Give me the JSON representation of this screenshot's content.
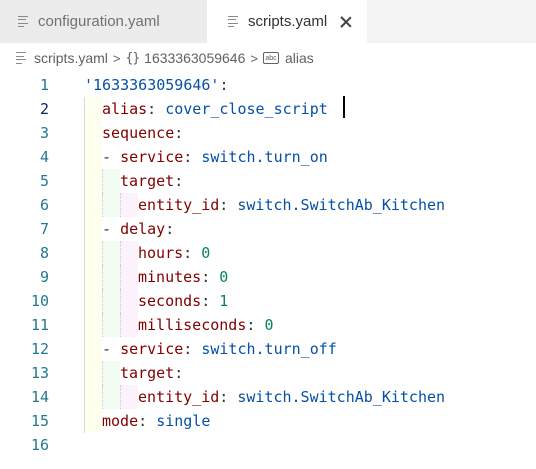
{
  "tabs": [
    {
      "label": "configuration.yaml",
      "active": false
    },
    {
      "label": "scripts.yaml",
      "active": true
    }
  ],
  "breadcrumb": {
    "file": "scripts.yaml",
    "separator": ">",
    "object": "1633363059646",
    "object_icon": "{}",
    "property": "alias",
    "property_icon": "abc"
  },
  "editor": {
    "current_line": 2,
    "lines": [
      {
        "n": "1",
        "tokens": [
          {
            "t": "str",
            "v": "'1633363059646'"
          },
          {
            "t": "punc",
            "v": ":"
          }
        ]
      },
      {
        "n": "2",
        "tokens": [
          {
            "t": "key",
            "v": "alias"
          },
          {
            "t": "punc",
            "v": ": "
          },
          {
            "t": "str",
            "v": "cover_close_script"
          }
        ]
      },
      {
        "n": "3",
        "tokens": [
          {
            "t": "key",
            "v": "sequence"
          },
          {
            "t": "punc",
            "v": ":"
          }
        ]
      },
      {
        "n": "4",
        "tokens": [
          {
            "t": "punc",
            "v": "- "
          },
          {
            "t": "key",
            "v": "service"
          },
          {
            "t": "punc",
            "v": ": "
          },
          {
            "t": "str",
            "v": "switch.turn_on"
          }
        ]
      },
      {
        "n": "5",
        "tokens": [
          {
            "t": "key",
            "v": "target"
          },
          {
            "t": "punc",
            "v": ":"
          }
        ]
      },
      {
        "n": "6",
        "tokens": [
          {
            "t": "key",
            "v": "entity_id"
          },
          {
            "t": "punc",
            "v": ": "
          },
          {
            "t": "str",
            "v": "switch.SwitchAb_Kitchen"
          }
        ]
      },
      {
        "n": "7",
        "tokens": [
          {
            "t": "punc",
            "v": "- "
          },
          {
            "t": "key",
            "v": "delay"
          },
          {
            "t": "punc",
            "v": ":"
          }
        ]
      },
      {
        "n": "8",
        "tokens": [
          {
            "t": "key",
            "v": "hours"
          },
          {
            "t": "punc",
            "v": ": "
          },
          {
            "t": "num",
            "v": "0"
          }
        ]
      },
      {
        "n": "9",
        "tokens": [
          {
            "t": "key",
            "v": "minutes"
          },
          {
            "t": "punc",
            "v": ": "
          },
          {
            "t": "num",
            "v": "0"
          }
        ]
      },
      {
        "n": "10",
        "tokens": [
          {
            "t": "key",
            "v": "seconds"
          },
          {
            "t": "punc",
            "v": ": "
          },
          {
            "t": "num",
            "v": "1"
          }
        ]
      },
      {
        "n": "11",
        "tokens": [
          {
            "t": "key",
            "v": "milliseconds"
          },
          {
            "t": "punc",
            "v": ": "
          },
          {
            "t": "num",
            "v": "0"
          }
        ]
      },
      {
        "n": "12",
        "tokens": [
          {
            "t": "punc",
            "v": "- "
          },
          {
            "t": "key",
            "v": "service"
          },
          {
            "t": "punc",
            "v": ": "
          },
          {
            "t": "str",
            "v": "switch.turn_off"
          }
        ]
      },
      {
        "n": "13",
        "tokens": [
          {
            "t": "key",
            "v": "target"
          },
          {
            "t": "punc",
            "v": ":"
          }
        ]
      },
      {
        "n": "14",
        "tokens": [
          {
            "t": "key",
            "v": "entity_id"
          },
          {
            "t": "punc",
            "v": ": "
          },
          {
            "t": "str",
            "v": "switch.SwitchAb_Kitchen"
          }
        ]
      },
      {
        "n": "15",
        "tokens": [
          {
            "t": "key",
            "v": "mode"
          },
          {
            "t": "punc",
            "v": ": "
          },
          {
            "t": "str",
            "v": "single"
          }
        ]
      },
      {
        "n": "16",
        "tokens": []
      }
    ]
  },
  "colors": {
    "key": "#800000",
    "string": "#0451a5",
    "number": "#098658",
    "line_number": "#237893"
  }
}
